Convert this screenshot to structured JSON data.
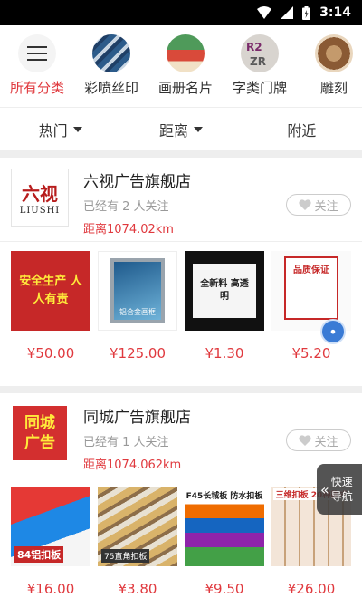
{
  "status": {
    "time": "3:14"
  },
  "categories": [
    {
      "label": "所有分类",
      "icon": "menu-icon",
      "active": true
    },
    {
      "label": "彩喷丝印",
      "icon": "spray-print-thumb",
      "active": false
    },
    {
      "label": "画册名片",
      "icon": "brochure-thumb",
      "active": false
    },
    {
      "label": "字类门牌",
      "icon": "doorplate-thumb",
      "active": false
    },
    {
      "label": "雕刻",
      "icon": "carving-thumb",
      "active": false
    }
  ],
  "filters": [
    {
      "label": "热门",
      "dropdown": true
    },
    {
      "label": "距离",
      "dropdown": true
    },
    {
      "label": "附近",
      "dropdown": false
    }
  ],
  "shops": [
    {
      "name": "六视广告旗舰店",
      "logo_text": "六视",
      "logo_sub": "LIUSHI",
      "followers": "已经有 2 人关注",
      "distance": "距离1074.02km",
      "follow_label": "关注",
      "products": [
        {
          "price": "¥50.00",
          "img_text": "安全生产 人人有责"
        },
        {
          "price": "¥125.00",
          "img_text": "铝合金画框"
        },
        {
          "price": "¥1.30",
          "img_text": "全新料 高透明"
        },
        {
          "price": "¥5.20",
          "img_text": "品质保证"
        }
      ]
    },
    {
      "name": "同城广告旗舰店",
      "logo_text": "同城广告",
      "logo_sub": "",
      "followers": "已经有 1 人关注",
      "distance": "距离1074.062km",
      "follow_label": "关注",
      "products": [
        {
          "price": "¥16.00",
          "img_text": "84铝扣板"
        },
        {
          "price": "¥3.80",
          "img_text": "75直角扣板"
        },
        {
          "price": "¥9.50",
          "img_text": "F45长城板 防水扣板"
        },
        {
          "price": "¥26.00",
          "img_text": "三维扣板 20种款式"
        }
      ]
    }
  ],
  "quick_nav": {
    "line1": "快速",
    "line2": "导航"
  },
  "colors": {
    "accent": "#e0393e",
    "background": "#f2f2f2"
  }
}
